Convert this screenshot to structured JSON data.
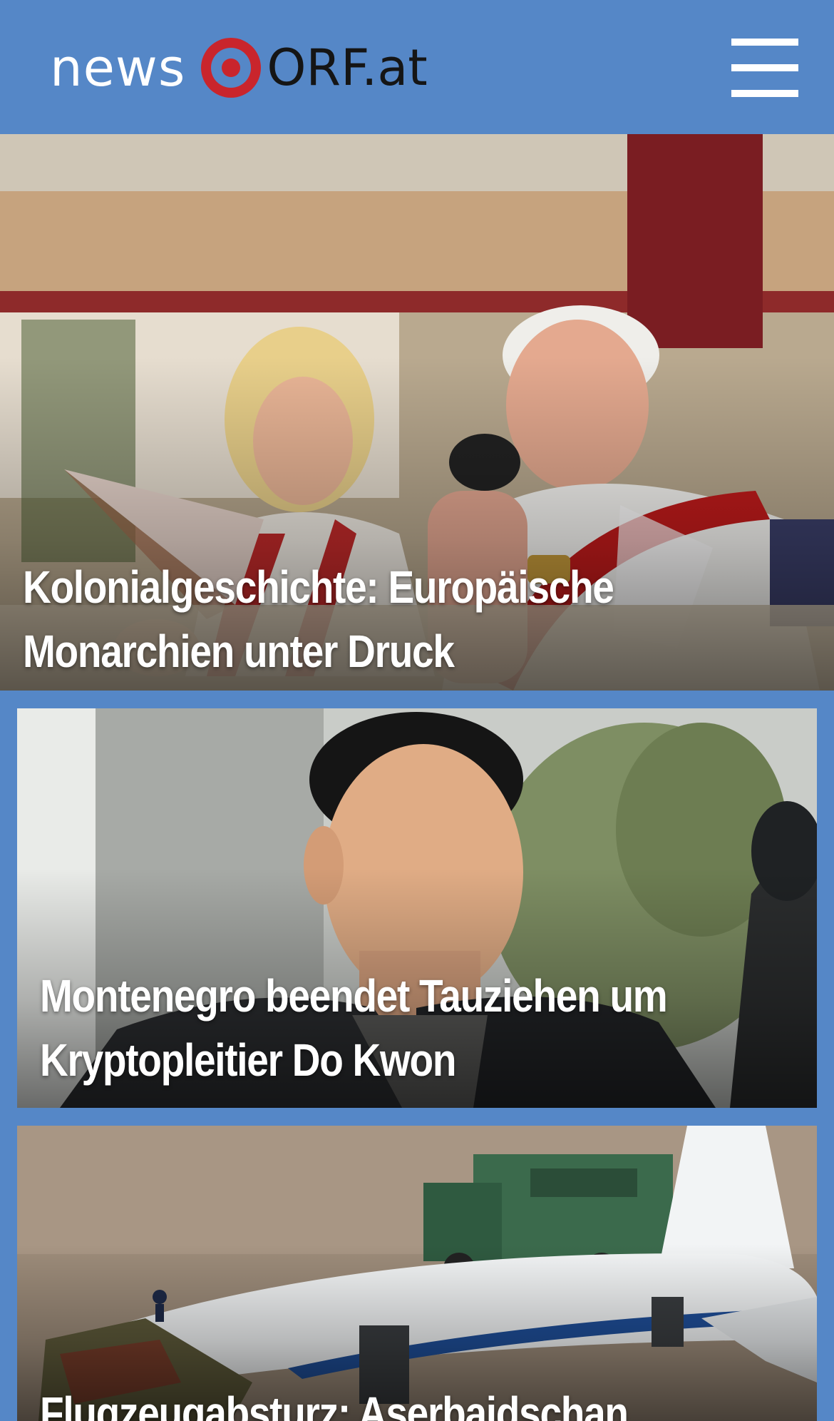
{
  "header": {
    "logo_news": "news",
    "logo_orf": "ORF.at",
    "menu_icon": "hamburger-menu-icon"
  },
  "stories": [
    {
      "headline_line1": "Kolonialgeschichte: Europäische",
      "headline_line2": "Monarchien unter Druck"
    },
    {
      "headline_line1": "Montenegro beendet Tauziehen um",
      "headline_line2": "Kryptopleitier Do Kwon"
    },
    {
      "headline_line1": "Flugzeugabsturz: Aserbaidschan"
    }
  ],
  "colors": {
    "brand_blue": "#5587c7",
    "logo_red": "#c9252c",
    "headline_text": "#ffffff"
  }
}
